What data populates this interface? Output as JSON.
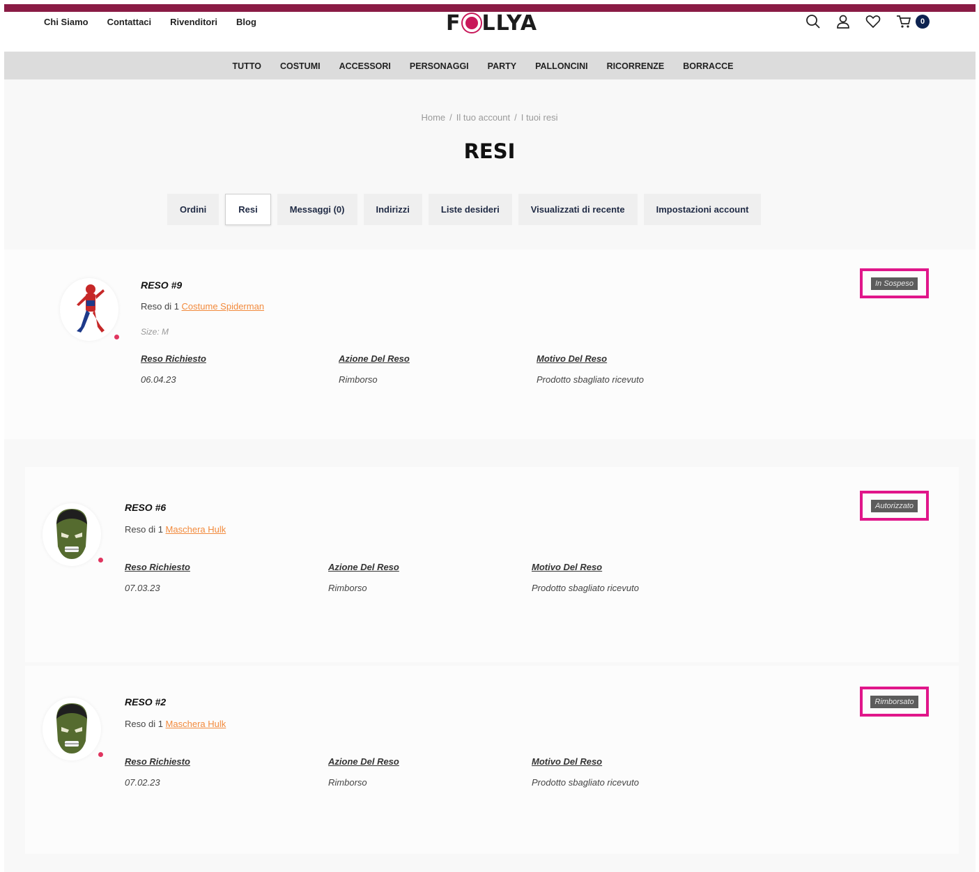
{
  "header": {
    "top_links": [
      "Chi Siamo",
      "Contattaci",
      "Rivenditori",
      "Blog"
    ],
    "logo_left": "F",
    "logo_right": "LLYA",
    "cart_count": "0",
    "icons": [
      "search-icon",
      "user-icon",
      "heart-icon",
      "cart-icon"
    ]
  },
  "categories": [
    "TUTTO",
    "COSTUMI",
    "ACCESSORI",
    "PERSONAGGI",
    "PARTY",
    "PALLONCINI",
    "RICORRENZE",
    "BORRACCE"
  ],
  "breadcrumb": [
    "Home",
    "Il tuo account",
    "I tuoi resi"
  ],
  "breadcrumb_sep": "/",
  "page_title": "RESI",
  "tabs": [
    "Ordini",
    "Resi",
    "Messaggi (0)",
    "Indirizzi",
    "Liste desideri",
    "Visualizzati di recente",
    "Impostazioni account"
  ],
  "active_tab": "Resi",
  "returns": [
    {
      "title": "RESO #9",
      "prefix": "Reso di 1",
      "product": "Costume Spiderman",
      "size": "Size: M",
      "labels": {
        "requested": "Reso Richiesto",
        "action": "Azione Del Reso",
        "reason": "Motivo Del Reso"
      },
      "requested": "06.04.23",
      "action": "Rimborso",
      "reason": "Prodotto sbagliato ricevuto",
      "status": "In Sospeso"
    },
    {
      "title": "RESO #6",
      "prefix": "Reso di 1",
      "product": "Maschera Hulk",
      "labels": {
        "requested": "Reso Richiesto",
        "action": "Azione Del Reso",
        "reason": "Motivo Del Reso"
      },
      "requested": "07.03.23",
      "action": "Rimborso",
      "reason": "Prodotto sbagliato ricevuto",
      "status": "Autorizzato"
    },
    {
      "title": "RESO #2",
      "prefix": "Reso di 1",
      "product": "Maschera Hulk",
      "labels": {
        "requested": "Reso Richiesto",
        "action": "Azione Del Reso",
        "reason": "Motivo Del Reso"
      },
      "requested": "07.02.23",
      "action": "Rimborso",
      "reason": "Prodotto sbagliato ricevuto",
      "status": "Rimborsato"
    }
  ],
  "colors": {
    "brand": "#8a1b45",
    "accent": "#c8185a",
    "link": "#f28a3c",
    "highlight": "#e0168a",
    "badge": "#0e2350"
  }
}
